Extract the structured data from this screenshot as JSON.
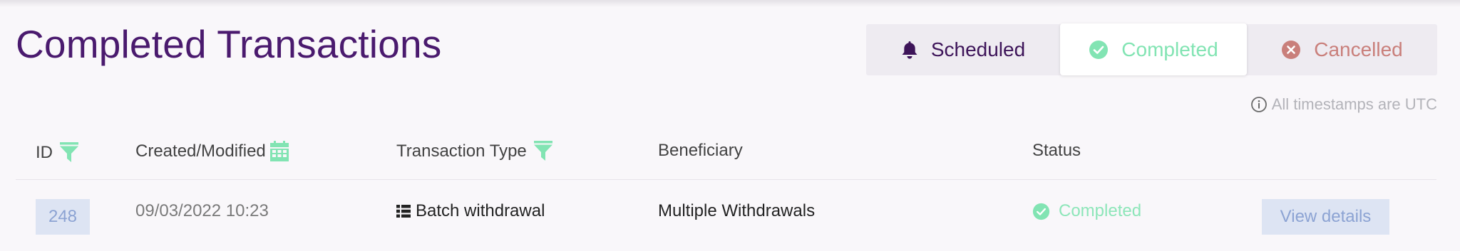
{
  "header": {
    "title": "Completed Transactions"
  },
  "tabs": [
    {
      "label": "Scheduled",
      "icon": "bell-icon",
      "color": "#3d1459"
    },
    {
      "label": "Completed",
      "icon": "check-circle-icon",
      "color": "#82e4b3",
      "active": true
    },
    {
      "label": "Cancelled",
      "icon": "x-circle-icon",
      "color": "#c97f7b"
    }
  ],
  "timezone_note": {
    "icon": "info-icon",
    "text": "All timestamps are UTC"
  },
  "table": {
    "columns": [
      {
        "label": "ID",
        "icon": "filter-icon"
      },
      {
        "label": "Created/Modified",
        "icon": "calendar-icon"
      },
      {
        "label": "Transaction Type",
        "icon": "filter-icon"
      },
      {
        "label": "Beneficiary"
      },
      {
        "label": "Status"
      }
    ],
    "rows": [
      {
        "id": "248",
        "created": "09/03/2022 10:23",
        "type": "Batch withdrawal",
        "type_icon": "list-icon",
        "beneficiary": "Multiple Withdrawals",
        "status": "Completed",
        "status_icon": "check-circle-icon",
        "action_label": "View details"
      }
    ]
  },
  "colors": {
    "title": "#4a1a6e",
    "accent_green": "#82e4b3",
    "cancel_red": "#c97f7b",
    "badge_bg": "#dde4f3",
    "badge_text": "#8ca3d3"
  }
}
